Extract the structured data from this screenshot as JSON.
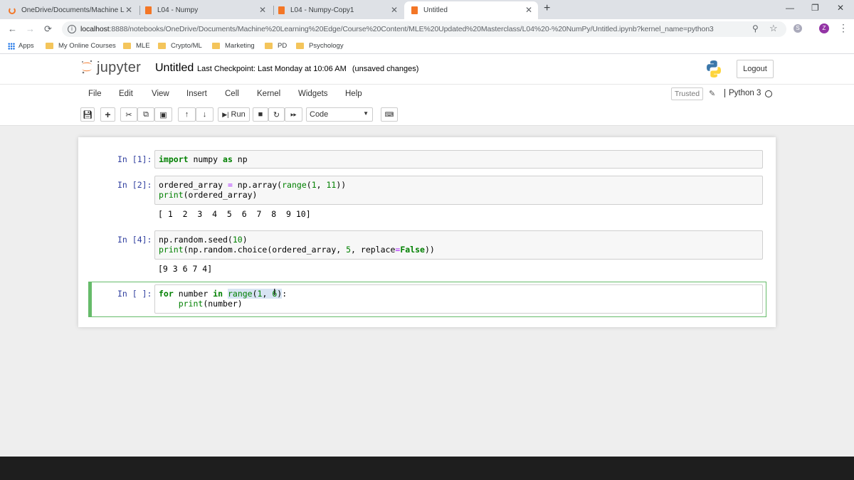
{
  "browser": {
    "tabs": [
      {
        "title": "OneDrive/Documents/Machine L",
        "active": false
      },
      {
        "title": "L04 - Numpy",
        "active": false
      },
      {
        "title": "L04 - Numpy-Copy1",
        "active": false
      },
      {
        "title": "Untitled",
        "active": true
      }
    ],
    "url_host": "localhost",
    "url_rest": ":8888/notebooks/OneDrive/Documents/Machine%20Learning%20Edge/Course%20Content/MLE%20Updated%20Masterclass/L04%20-%20NumPy/Untitled.ipynb?kernel_name=python3",
    "profile_initial": "Z",
    "bookmarks": [
      "Apps",
      "My Online Courses",
      "MLE",
      "Crypto/ML",
      "Marketing",
      "PD",
      "Psychology"
    ]
  },
  "jupyter": {
    "logo_text": "jupyter",
    "notebook_title": "Untitled",
    "checkpoint": "Last Checkpoint: Last Monday at 10:06 AM",
    "unsaved": "(unsaved changes)",
    "logout": "Logout",
    "menu": [
      "File",
      "Edit",
      "View",
      "Insert",
      "Cell",
      "Kernel",
      "Widgets",
      "Help"
    ],
    "trusted": "Trusted",
    "kernel": "Python 3",
    "toolbar": {
      "run": "Run",
      "cell_type": "Code"
    }
  },
  "cells": [
    {
      "prompt": "In [1]:",
      "output": ""
    },
    {
      "prompt": "In [2]:",
      "output": "[ 1  2  3  4  5  6  7  8  9 10]"
    },
    {
      "prompt": "In [4]:",
      "output": "[9 3 6 7 4]"
    },
    {
      "prompt": "In [ ]:",
      "output": ""
    }
  ],
  "colors": {
    "accent_orange": "#f37626",
    "prompt_blue": "#303f9f",
    "selected_green": "#66bb6a",
    "keyword_green": "#008000"
  }
}
